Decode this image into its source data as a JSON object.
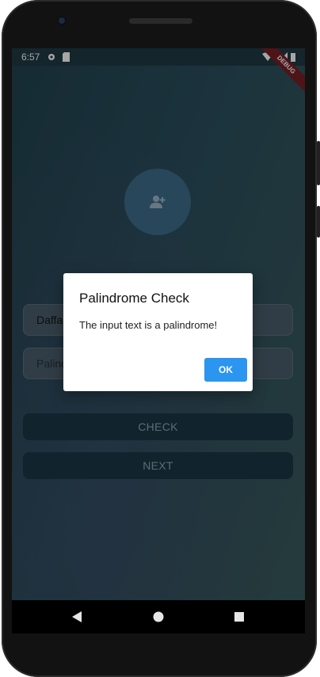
{
  "status_bar": {
    "time": "6:57"
  },
  "debug_banner": {
    "label": "DEBUG",
    "color": "#7a1f26"
  },
  "form": {
    "name_field_value": "Daffa",
    "palindrome_field_text": "Palind",
    "check_button_label": "CHECK",
    "next_button_label": "NEXT"
  },
  "dialog": {
    "title": "Palindrome Check",
    "message": "The input text is a palindrome!",
    "ok_button_label": "OK",
    "ok_button_color": "#2b95f0"
  },
  "icons": {
    "avatar": "add-person-icon",
    "nav_back": "back-triangle-icon",
    "nav_home": "home-circle-icon",
    "nav_recents": "recents-square-icon"
  }
}
